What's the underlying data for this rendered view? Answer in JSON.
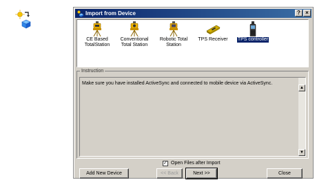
{
  "dialog": {
    "title": "Import from Device",
    "help_button": "?",
    "close_button": "×",
    "devices": [
      {
        "label_line1": "CE Based",
        "label_line2": "TotalStation",
        "icon": "ce-totalstation-icon",
        "selected": false
      },
      {
        "label_line1": "Conventional",
        "label_line2": "Total Station",
        "icon": "conventional-totalstation-icon",
        "selected": false
      },
      {
        "label_line1": "Robotic Total",
        "label_line2": "Station",
        "icon": "robotic-totalstation-icon",
        "selected": false
      },
      {
        "label_line1": "TPS Receiver",
        "label_line2": "",
        "icon": "tps-receiver-icon",
        "selected": false
      },
      {
        "label_line1": "TPS controller",
        "label_line2": "",
        "icon": "tps-controller-icon",
        "selected": true
      }
    ],
    "instruction_label": "Instruction",
    "instruction_text": "Make sure you have installed ActiveSync and connected to mobile device via ActiveSync.",
    "open_files_label": "Open Files after Import",
    "open_files_checked": true,
    "buttons": {
      "add_new_device": "Add New Device",
      "back": "<< Back",
      "next": "Next >>",
      "close": "Close"
    }
  },
  "colors": {
    "title_bar_start": "#0a246a",
    "title_bar_end": "#3a6ea5",
    "dialog_face": "#d4d0c8",
    "selection": "#0a246a"
  }
}
